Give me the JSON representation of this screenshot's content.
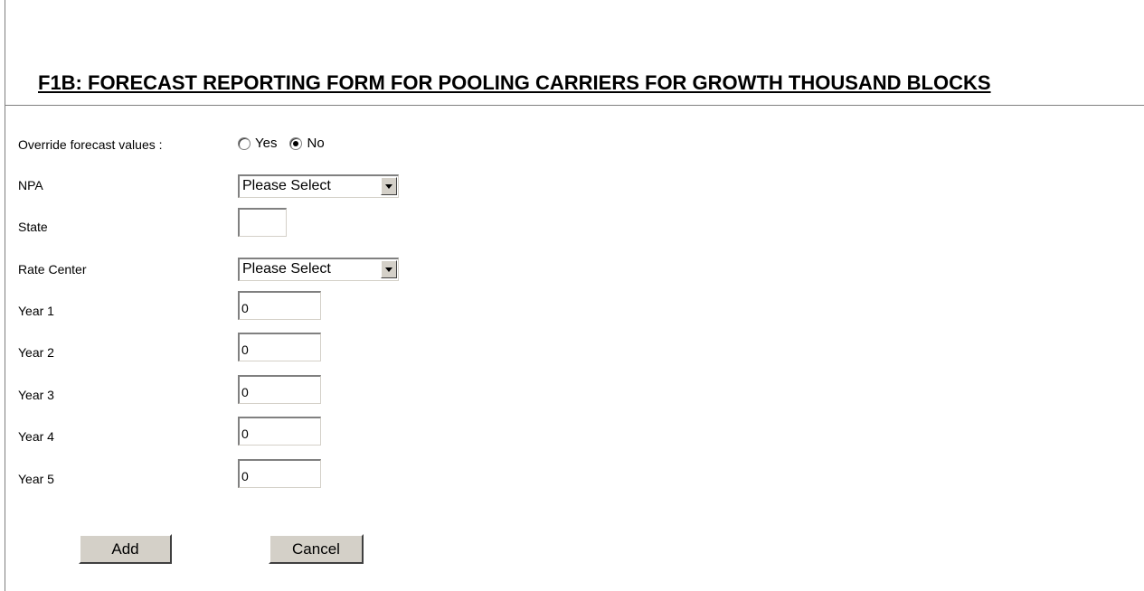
{
  "form": {
    "title": "F1B: FORECAST REPORTING FORM FOR POOLING CARRIERS FOR GROWTH THOUSAND BLOCKS",
    "override": {
      "label": "Override forecast values :",
      "options": [
        {
          "label": "Yes",
          "checked": false
        },
        {
          "label": "No",
          "checked": true
        }
      ]
    },
    "npa": {
      "label": "NPA",
      "selected": "Please Select"
    },
    "state": {
      "label": "State",
      "value": ""
    },
    "rate_center": {
      "label": "Rate Center",
      "selected": "Please Select"
    },
    "years": [
      {
        "label": "Year 1",
        "value": "0"
      },
      {
        "label": "Year 2",
        "value": "0"
      },
      {
        "label": "Year 3",
        "value": "0"
      },
      {
        "label": "Year 4",
        "value": "0"
      },
      {
        "label": "Year 5",
        "value": "0"
      }
    ],
    "buttons": {
      "add": "Add",
      "cancel": "Cancel"
    }
  }
}
